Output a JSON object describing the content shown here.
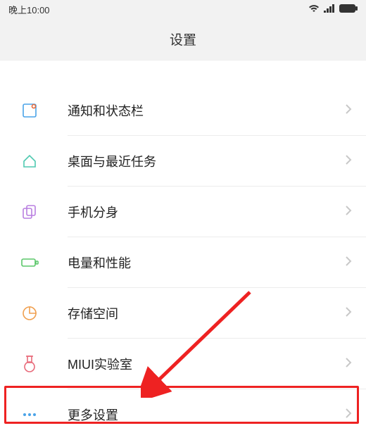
{
  "status": {
    "time": "晚上10:00"
  },
  "header": {
    "title": "设置"
  },
  "items": [
    {
      "icon": "notification-icon",
      "label": "通知和状态栏"
    },
    {
      "icon": "home-icon",
      "label": "桌面与最近任务"
    },
    {
      "icon": "clone-icon",
      "label": "手机分身"
    },
    {
      "icon": "battery-icon",
      "label": "电量和性能"
    },
    {
      "icon": "storage-icon",
      "label": "存储空间"
    },
    {
      "icon": "lab-icon",
      "label": "MIUI实验室"
    },
    {
      "icon": "more-icon",
      "label": "更多设置"
    }
  ],
  "annotation": {
    "highlight_index": 6
  }
}
